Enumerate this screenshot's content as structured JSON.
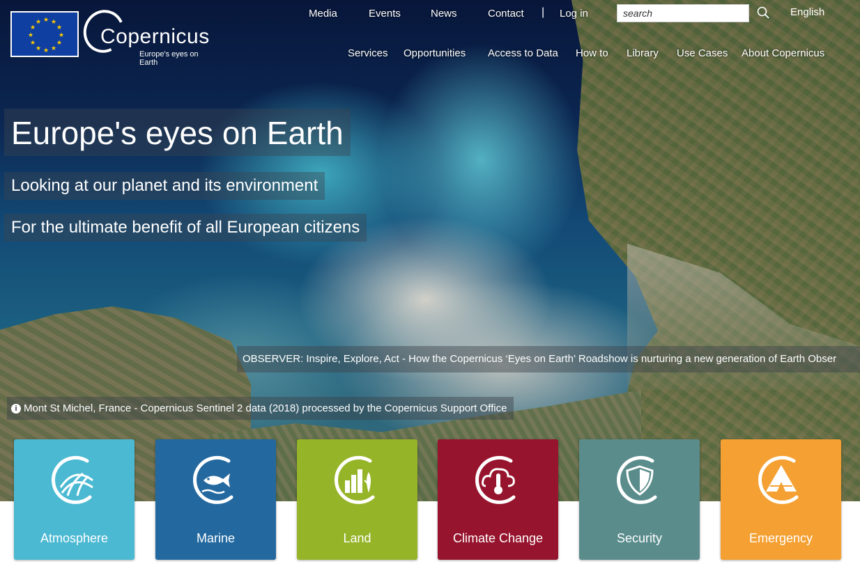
{
  "brand": {
    "eu_flag": "eu-flag",
    "name": "Copernicus",
    "tagline": "Europe's eyes on Earth"
  },
  "top_nav": [
    "Media",
    "Events",
    "News",
    "Contact"
  ],
  "auth": {
    "login": "Log in",
    "separator": "|"
  },
  "search": {
    "placeholder": "search",
    "value": ""
  },
  "language": "English",
  "main_nav": [
    "Services",
    "Opportunities",
    "Access to Data",
    "How to",
    "Library",
    "Use Cases",
    "About Copernicus"
  ],
  "hero": {
    "headline": "Europe's eyes on Earth",
    "sub1": "Looking at our planet and its environment",
    "sub2": "For the ultimate benefit of all European citizens",
    "news": "OBSERVER: Inspire, Explore, Act - How the Copernicus ‘Eyes on Earth’ Roadshow is nurturing a new generation of Earth Obser",
    "credit": "Mont St Michel, France - Copernicus Sentinel 2 data (2018) processed by the Copernicus Support Office"
  },
  "services": [
    {
      "label": "Atmosphere",
      "color": "#4bb9d2",
      "icon": "atmosphere-icon"
    },
    {
      "label": "Marine",
      "color": "#2369a0",
      "icon": "fish-icon"
    },
    {
      "label": "Land",
      "color": "#96b428",
      "icon": "land-icon"
    },
    {
      "label": "Climate Change",
      "color": "#96142d",
      "icon": "climate-cloud-icon"
    },
    {
      "label": "Security",
      "color": "#5a8c8c",
      "icon": "shield-icon"
    },
    {
      "label": "Emergency",
      "color": "#f5a032",
      "icon": "emergency-icon"
    }
  ]
}
